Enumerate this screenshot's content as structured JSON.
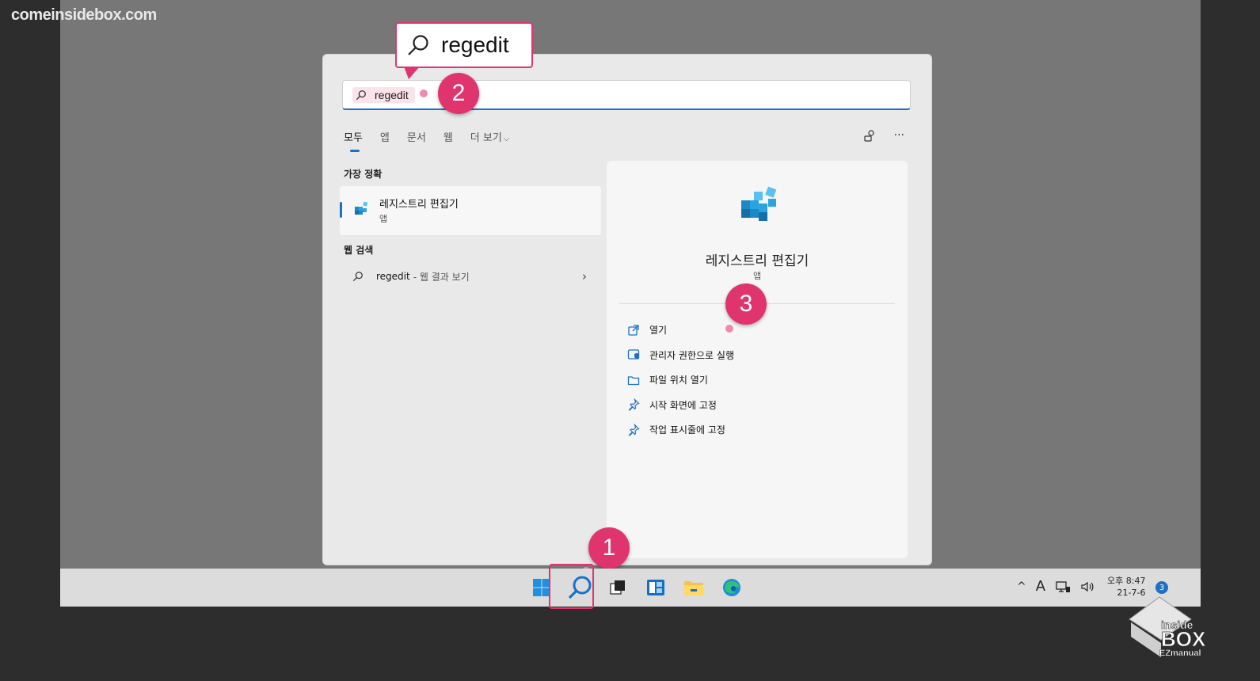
{
  "watermark": "comeinsidebox.com",
  "callout": {
    "query": "regedit"
  },
  "search": {
    "query": "regedit"
  },
  "tabs": [
    {
      "label": "모두",
      "active": true
    },
    {
      "label": "앱"
    },
    {
      "label": "문서"
    },
    {
      "label": "웹"
    },
    {
      "label": "더 보기"
    }
  ],
  "tools": {
    "more": "···"
  },
  "best_match": {
    "section_title": "가장 정확",
    "name": "레지스트리 편집기",
    "type": "앱"
  },
  "web_search": {
    "section_title": "웹 검색",
    "query": "regedit",
    "hint": "- 웹 결과 보기"
  },
  "detail": {
    "title": "레지스트리 편집기",
    "type": "앱",
    "actions": [
      {
        "label": "열기",
        "icon": "open-icon"
      },
      {
        "label": "관리자 권한으로 실행",
        "icon": "admin-shield-icon"
      },
      {
        "label": "파일 위치 열기",
        "icon": "folder-icon"
      },
      {
        "label": "시작 화면에 고정",
        "icon": "pin-icon"
      },
      {
        "label": "작업 표시줄에 고정",
        "icon": "pin-icon"
      }
    ]
  },
  "steps": {
    "one": "1",
    "two": "2",
    "three": "3"
  },
  "taskbar": {
    "clock_time": "오후 8:47",
    "clock_date": "21-7-6",
    "notification_count": "3",
    "ime": "A",
    "tray_chevron": "^"
  },
  "logo": {
    "line1": "inside",
    "line2": "BOX",
    "line3": "EZmanual"
  },
  "colors": {
    "accent": "#1f6fc5",
    "callout": "#e0346f"
  }
}
